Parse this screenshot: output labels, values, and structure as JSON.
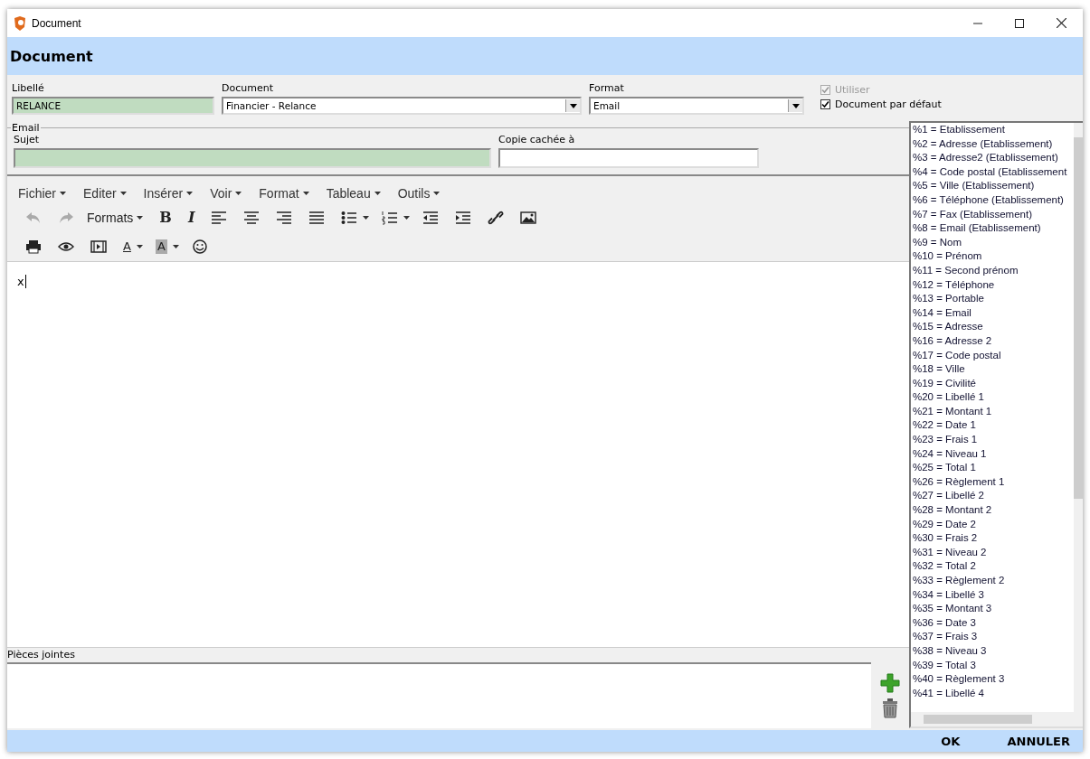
{
  "window": {
    "title": "Document"
  },
  "header": {
    "title": "Document"
  },
  "form": {
    "libelle": {
      "label": "Libellé",
      "value": "RELANCE"
    },
    "document": {
      "label": "Document",
      "value": "Financier - Relance"
    },
    "format": {
      "label": "Format",
      "value": "Email"
    },
    "checkboxes": [
      {
        "label": "Utiliser",
        "checked": true,
        "disabled": true
      },
      {
        "label": "Document par défaut",
        "checked": true,
        "disabled": false
      }
    ]
  },
  "email": {
    "legend": "Email",
    "subject": {
      "label": "Sujet"
    },
    "bcc": {
      "label": "Copie cachée à"
    }
  },
  "editor": {
    "menus": [
      "Fichier",
      "Editer",
      "Insérer",
      "Voir",
      "Format",
      "Tableau",
      "Outils"
    ],
    "toolbar_rows": [
      [
        {
          "kind": "undo",
          "disabled": true
        },
        {
          "kind": "redo",
          "disabled": true
        },
        {
          "kind": "formats",
          "label": "Formats",
          "disabled": false
        },
        {
          "kind": "bold",
          "label": "B",
          "disabled": false
        },
        {
          "kind": "italic",
          "label": "I",
          "disabled": false
        },
        {
          "kind": "align-left",
          "disabled": false
        },
        {
          "kind": "align-center",
          "disabled": false
        },
        {
          "kind": "align-right",
          "disabled": false
        },
        {
          "kind": "justify",
          "disabled": false
        },
        {
          "kind": "bullet-list",
          "disabled": false
        },
        {
          "kind": "numbered-list",
          "disabled": false
        },
        {
          "kind": "outdent",
          "disabled": false
        },
        {
          "kind": "indent",
          "disabled": false
        },
        {
          "kind": "link",
          "disabled": false
        },
        {
          "kind": "image",
          "disabled": false
        }
      ],
      [
        {
          "kind": "print",
          "disabled": false
        },
        {
          "kind": "preview",
          "disabled": false
        },
        {
          "kind": "media",
          "disabled": false
        },
        {
          "kind": "text-color",
          "label": "A",
          "disabled": false
        },
        {
          "kind": "background-color",
          "label": "A",
          "disabled": false
        },
        {
          "kind": "emoji",
          "disabled": false
        }
      ]
    ],
    "content": "x"
  },
  "attachments": {
    "label": "Pièces jointes"
  },
  "variables": [
    "%1 = Etablissement",
    "%2 = Adresse (Etablissement)",
    "%3 = Adresse2 (Etablissement)",
    "%4 = Code postal (Etablissement",
    "%5 = Ville (Etablissement)",
    "%6 = Téléphone (Etablissement)",
    "%7 = Fax (Etablissement)",
    "%8 = Email (Etablissement)",
    "%9 = Nom",
    "%10 = Prénom",
    "%11 = Second prénom",
    "%12 = Téléphone",
    "%13 = Portable",
    "%14 = Email",
    "%15 = Adresse",
    "%16 = Adresse 2",
    "%17 = Code postal",
    "%18 = Ville",
    "%19 = Civilité",
    "%20 = Libellé 1",
    "%21 = Montant 1",
    "%22 = Date 1",
    "%23 = Frais 1",
    "%24 = Niveau 1",
    "%25 = Total 1",
    "%26 = Règlement 1",
    "%27 = Libellé 2",
    "%28 = Montant 2",
    "%29 = Date 2",
    "%30 = Frais 2",
    "%31 = Niveau 2",
    "%32 = Total 2",
    "%33 = Règlement 2",
    "%34 = Libellé 3",
    "%35 = Montant 3",
    "%36 = Date 3",
    "%37 = Frais 3",
    "%38 = Niveau 3",
    "%39 = Total 3",
    "%40 = Règlement 3",
    "%41 = Libellé 4"
  ],
  "buttons": [
    "OK",
    "ANNULER"
  ]
}
